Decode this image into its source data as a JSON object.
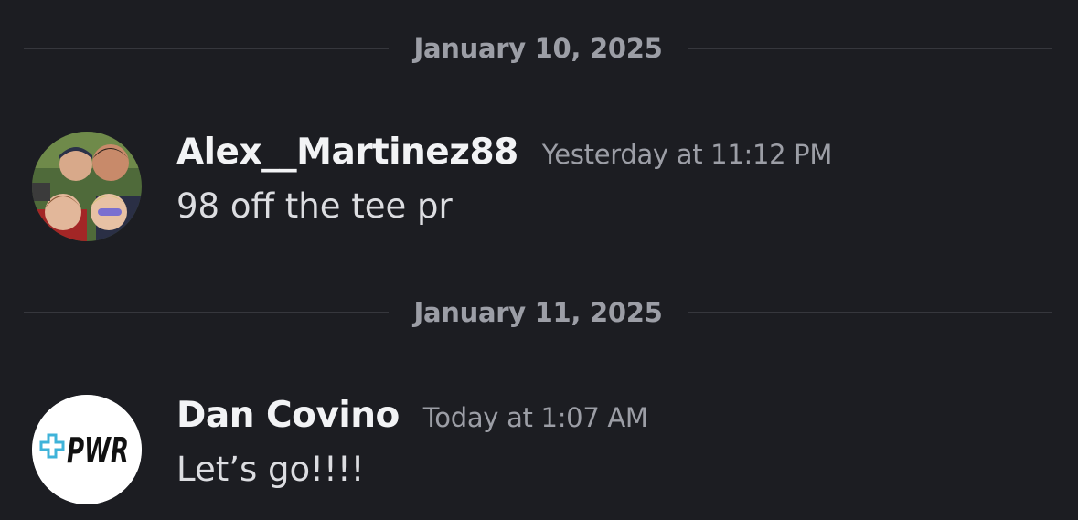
{
  "chat": {
    "dividers": [
      {
        "date": "January 10, 2025"
      },
      {
        "date": "January 11, 2025"
      }
    ],
    "messages": [
      {
        "author": "Alex__Martinez88",
        "timestamp": "Yesterday at 11:12 PM",
        "text": "98 off the tee pr",
        "avatar": "group-photo"
      },
      {
        "author": "Dan Covino",
        "timestamp": "Today at 1:07 AM",
        "text": "Let’s go!!!!",
        "avatar": {
          "logo_text": "PWR",
          "logo_icon": "plus-icon",
          "accent": "#3fb3d9"
        }
      }
    ]
  },
  "colors": {
    "background": "#1c1d22",
    "divider_line": "#36373d",
    "muted_text": "#9c9ea6",
    "username": "#f2f3f5"
  }
}
